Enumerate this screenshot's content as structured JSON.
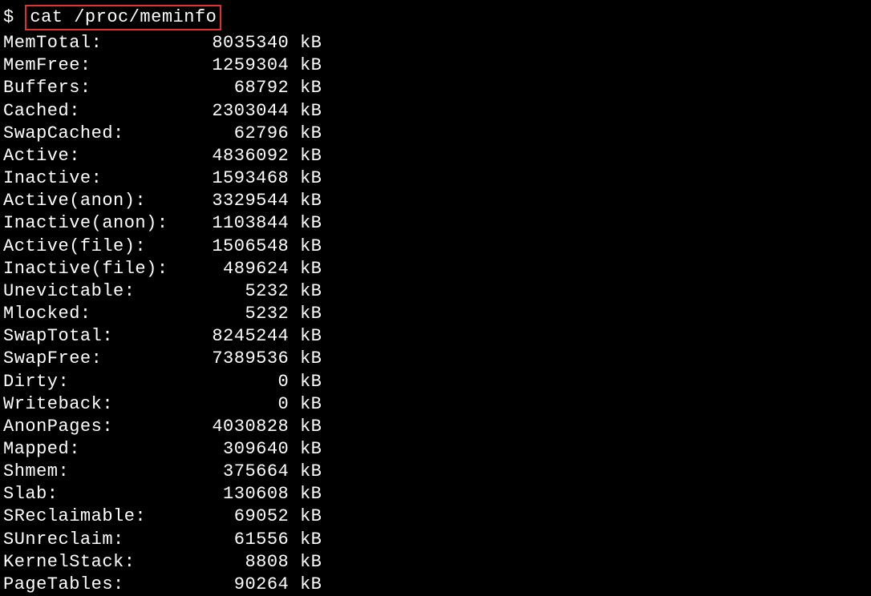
{
  "prompt": {
    "symbol": "$",
    "command": "cat /proc/meminfo"
  },
  "meminfo": [
    {
      "label": "MemTotal:",
      "value": "8035340",
      "unit": "kB"
    },
    {
      "label": "MemFree:",
      "value": "1259304",
      "unit": "kB"
    },
    {
      "label": "Buffers:",
      "value": "68792",
      "unit": "kB"
    },
    {
      "label": "Cached:",
      "value": "2303044",
      "unit": "kB"
    },
    {
      "label": "SwapCached:",
      "value": "62796",
      "unit": "kB"
    },
    {
      "label": "Active:",
      "value": "4836092",
      "unit": "kB"
    },
    {
      "label": "Inactive:",
      "value": "1593468",
      "unit": "kB"
    },
    {
      "label": "Active(anon):",
      "value": "3329544",
      "unit": "kB"
    },
    {
      "label": "Inactive(anon):",
      "value": "1103844",
      "unit": "kB"
    },
    {
      "label": "Active(file):",
      "value": "1506548",
      "unit": "kB"
    },
    {
      "label": "Inactive(file):",
      "value": "489624",
      "unit": "kB"
    },
    {
      "label": "Unevictable:",
      "value": "5232",
      "unit": "kB"
    },
    {
      "label": "Mlocked:",
      "value": "5232",
      "unit": "kB"
    },
    {
      "label": "SwapTotal:",
      "value": "8245244",
      "unit": "kB"
    },
    {
      "label": "SwapFree:",
      "value": "7389536",
      "unit": "kB"
    },
    {
      "label": "Dirty:",
      "value": "0",
      "unit": "kB"
    },
    {
      "label": "Writeback:",
      "value": "0",
      "unit": "kB"
    },
    {
      "label": "AnonPages:",
      "value": "4030828",
      "unit": "kB"
    },
    {
      "label": "Mapped:",
      "value": "309640",
      "unit": "kB"
    },
    {
      "label": "Shmem:",
      "value": "375664",
      "unit": "kB"
    },
    {
      "label": "Slab:",
      "value": "130608",
      "unit": "kB"
    },
    {
      "label": "SReclaimable:",
      "value": "69052",
      "unit": "kB"
    },
    {
      "label": "SUnreclaim:",
      "value": "61556",
      "unit": "kB"
    },
    {
      "label": "KernelStack:",
      "value": "8808",
      "unit": "kB"
    },
    {
      "label": "PageTables:",
      "value": "90264",
      "unit": "kB"
    }
  ]
}
